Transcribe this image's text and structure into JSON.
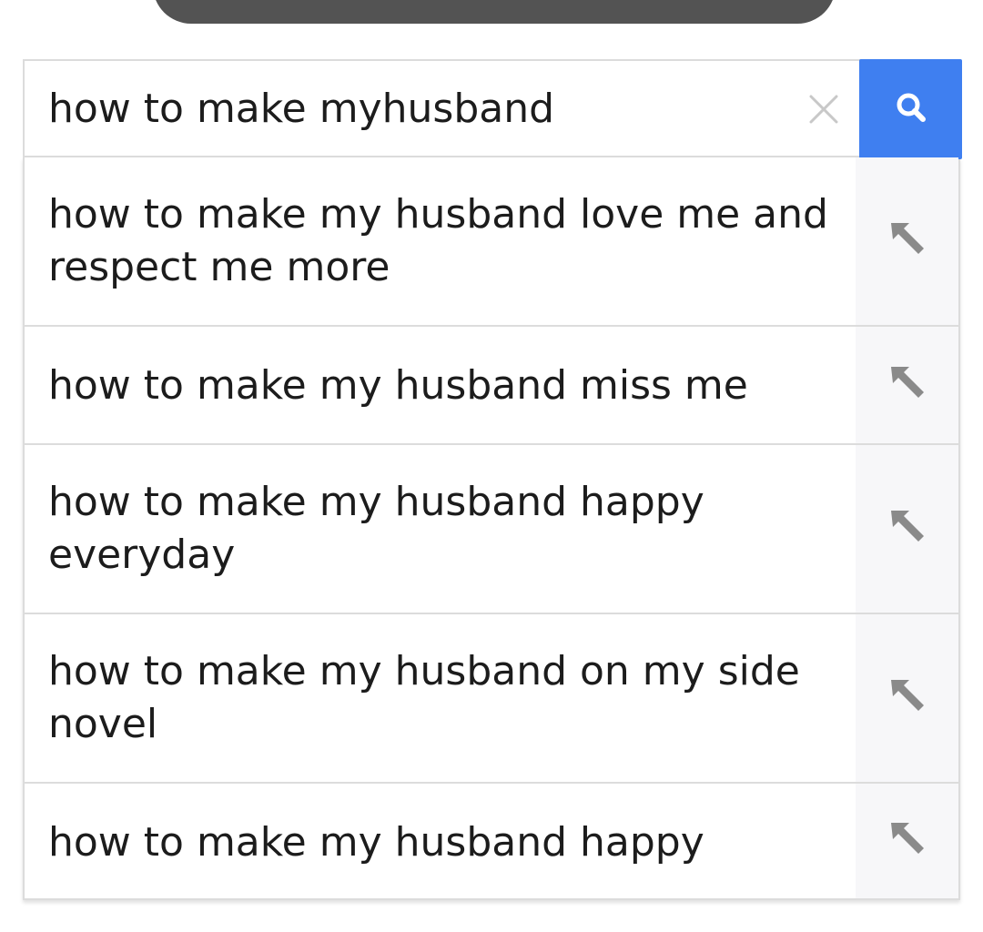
{
  "search": {
    "query": "how to make myhusband",
    "clear_icon": "close-icon",
    "submit_icon": "search-icon",
    "accent_color": "#3f7ff0"
  },
  "suggestions": [
    {
      "text": "how to make my husband love me and respect me more",
      "icon": "fill-arrow-icon"
    },
    {
      "text": "how to make my husband miss me",
      "icon": "fill-arrow-icon"
    },
    {
      "text": "how to make my husband happy everyday",
      "icon": "fill-arrow-icon"
    },
    {
      "text": "how to make my husband on my side novel",
      "icon": "fill-arrow-icon"
    },
    {
      "text": "how to make my husband happy",
      "icon": "fill-arrow-icon"
    }
  ]
}
